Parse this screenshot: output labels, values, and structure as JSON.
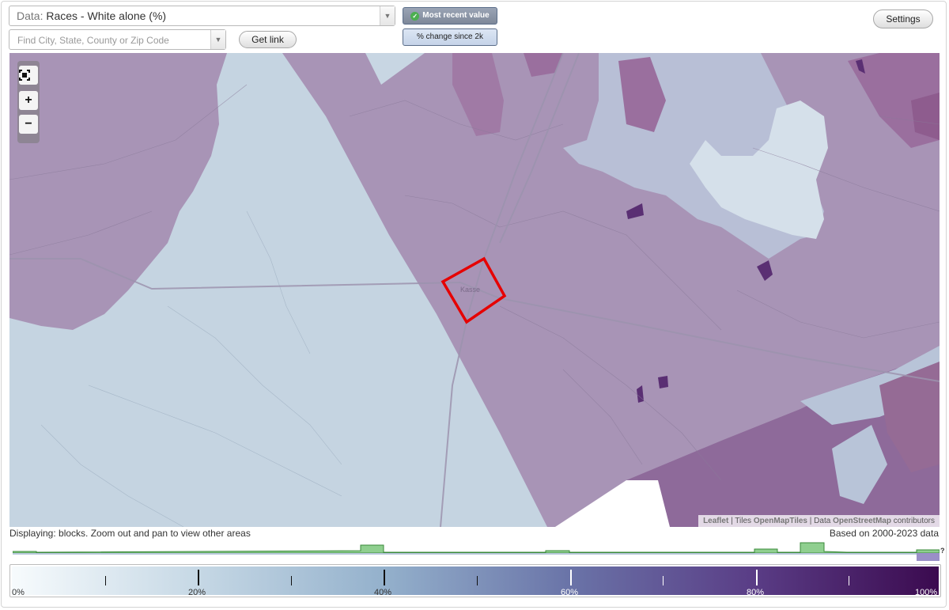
{
  "data_selector": {
    "prefix": "Data:",
    "value": "Races - White alone (%)"
  },
  "search": {
    "placeholder": "Find City, State, County or Zip Code"
  },
  "buttons": {
    "get_link": "Get link",
    "settings": "Settings"
  },
  "toggles": {
    "most_recent": "Most recent value",
    "change": "% change since 2k"
  },
  "map": {
    "place_label": "Kasse",
    "attribution": {
      "leaflet": "Leaflet",
      "sep": " | ",
      "tiles_prefix": "Tiles ",
      "tiles": "OpenMapTiles",
      "data_prefix": "Data ",
      "data": "OpenStreetMap",
      "data_suffix": " contributors"
    }
  },
  "footer": {
    "displaying": "Displaying: blocks. Zoom out and pan to view other areas",
    "based_on": "Based on 2000-2023 data"
  },
  "histogram_unknown": "?",
  "legend": {
    "labels": [
      "0%",
      "20%",
      "40%",
      "60%",
      "80%",
      "100%"
    ]
  },
  "colors": {
    "low": "#c7d5e1",
    "mid": "#a894b6",
    "high": "#8e6a9a",
    "very_high": "#5a2f73",
    "highlight": "#e60000",
    "hist_green": "#8fcf8f",
    "hist_line": "#3a8a3a"
  }
}
